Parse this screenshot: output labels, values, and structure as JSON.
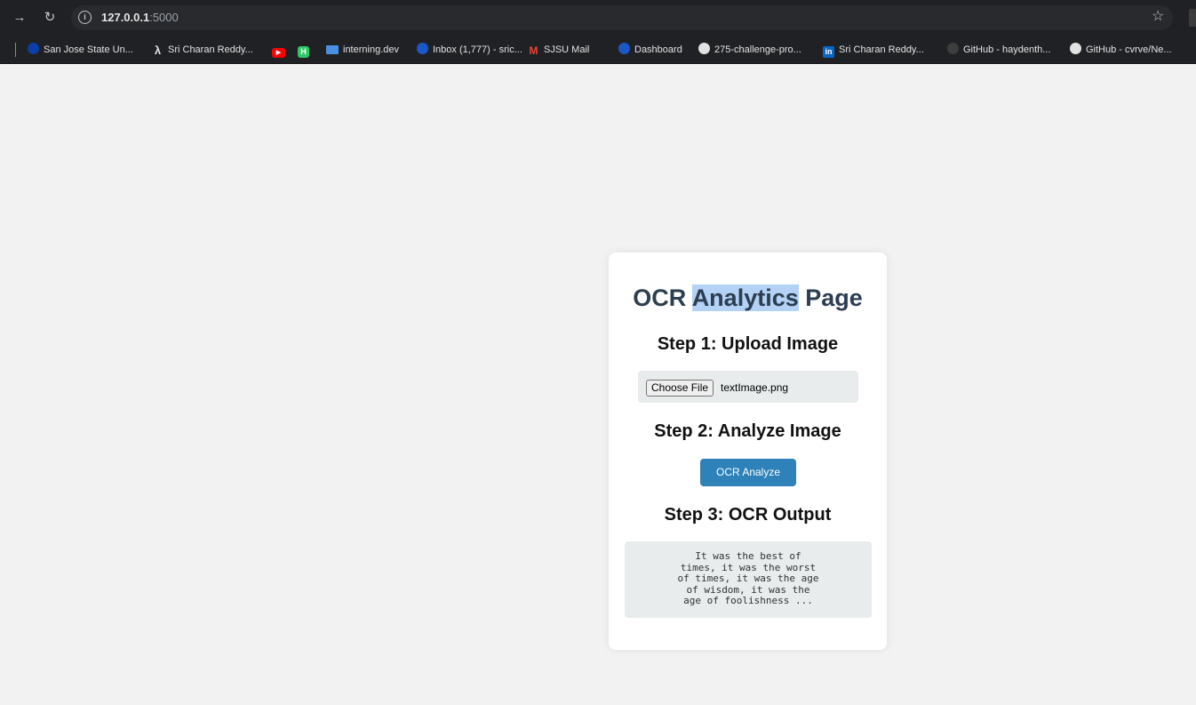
{
  "browser": {
    "url_host": "127.0.0.1",
    "url_port": ":5000",
    "bookmarks": [
      {
        "label": "San Jose State Un...",
        "icon": "sjsu-icon"
      },
      {
        "label": "Sri Charan Reddy...",
        "icon": "lambda-icon"
      },
      {
        "label": "",
        "icon": "youtube-icon"
      },
      {
        "label": "",
        "icon": "hackerrank-icon"
      },
      {
        "label": "interning.dev",
        "icon": "laptop-icon"
      },
      {
        "label": "Inbox (1,777) - sric...",
        "icon": "inbox-icon"
      },
      {
        "label": "SJSU Mail",
        "icon": "gmail-icon"
      },
      {
        "label": "Dashboard",
        "icon": "dashboard-icon"
      },
      {
        "label": "275-challenge-pro...",
        "icon": "github-icon"
      },
      {
        "label": "Sri Charan Reddy...",
        "icon": "linkedin-icon"
      },
      {
        "label": "GitHub - haydenth...",
        "icon": "github-icon"
      },
      {
        "label": "GitHub - cvrve/Ne...",
        "icon": "github-icon"
      }
    ]
  },
  "page": {
    "title_part1": "OCR ",
    "title_highlight": "Analytics",
    "title_part2": " Page",
    "step1_heading": "Step 1: Upload Image",
    "choose_file_label": "Choose File",
    "file_name": "textImage.png",
    "step2_heading": "Step 2: Analyze Image",
    "analyze_button_label": "OCR Analyze",
    "step3_heading": "Step 3: OCR Output",
    "ocr_output": "It was the best of\ntimes, it was the worst\nof times, it was the age\nof wisdom, it was the\nage of foolishness ..."
  }
}
